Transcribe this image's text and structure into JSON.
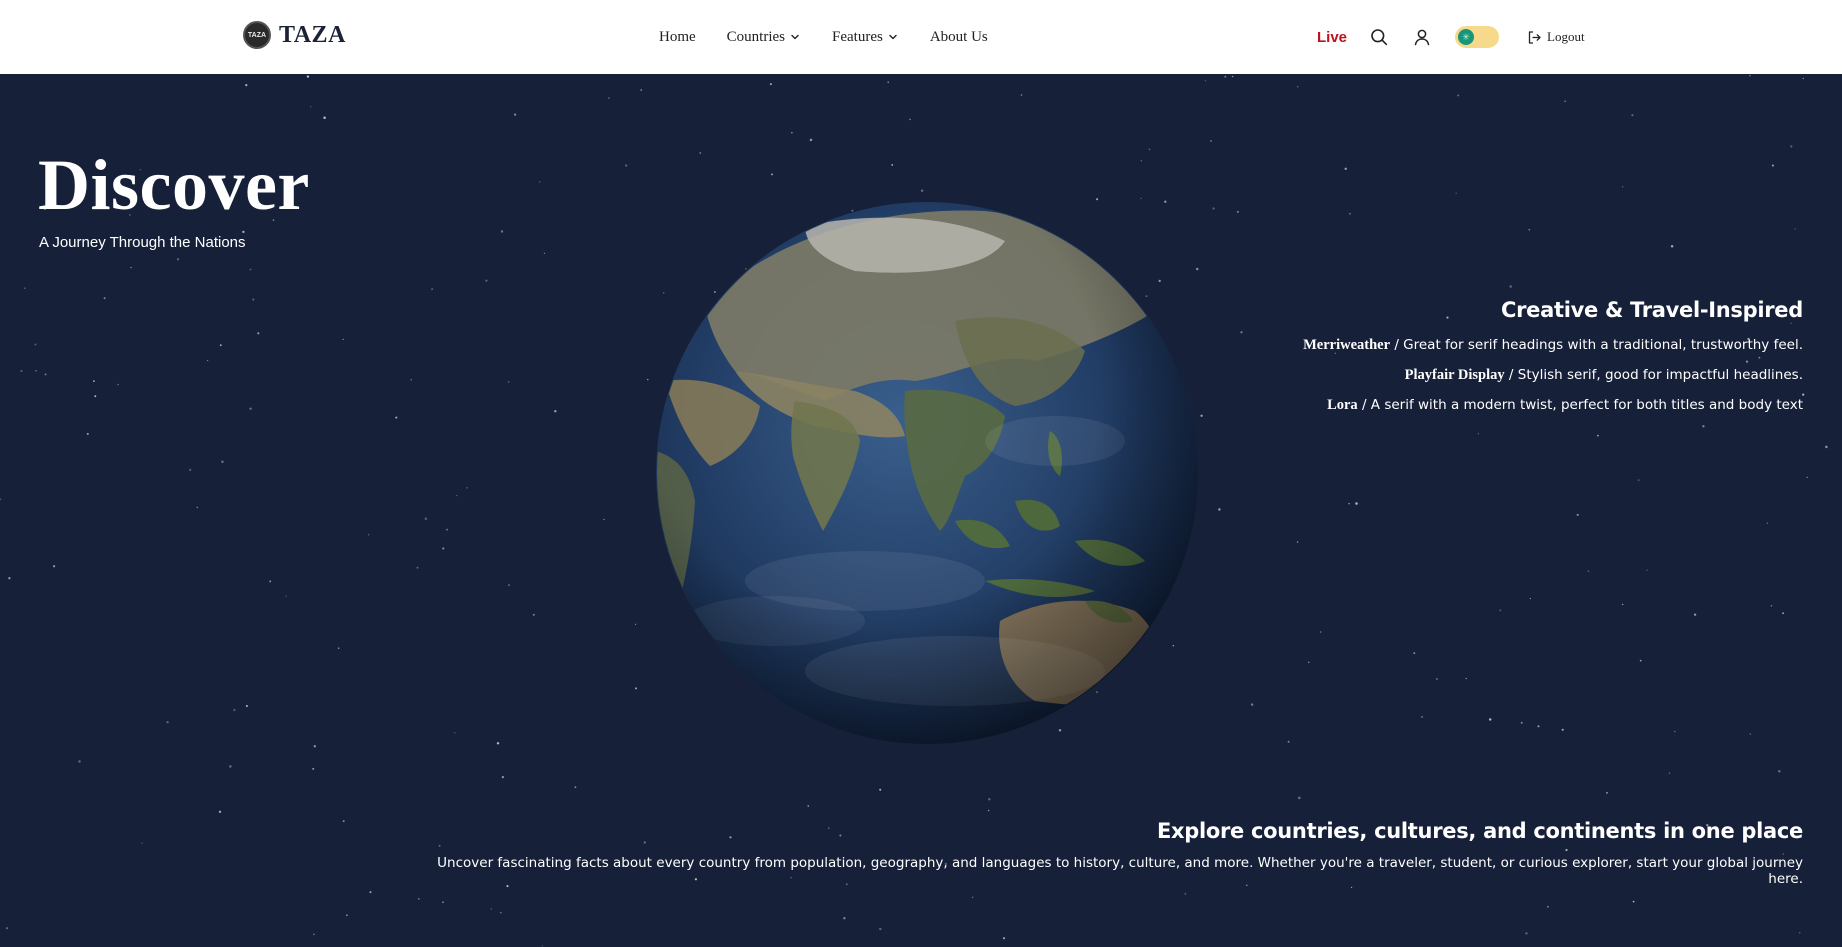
{
  "brand": {
    "logo_text": "TAZA",
    "name": "TAZA"
  },
  "nav": {
    "items": [
      {
        "label": "Home",
        "dropdown": false
      },
      {
        "label": "Countries",
        "dropdown": true
      },
      {
        "label": "Features",
        "dropdown": true
      },
      {
        "label": "About Us",
        "dropdown": false
      }
    ]
  },
  "toolbar": {
    "live_label": "Live",
    "search_icon": "search-icon",
    "user_icon": "user-icon",
    "theme_toggle_on": true,
    "logout_label": "Logout"
  },
  "hero": {
    "title": "Discover",
    "subtitle": "A Journey Through the Nations"
  },
  "fonts_section": {
    "heading": "Creative & Travel-Inspired",
    "lines": [
      {
        "name": "Merriweather",
        "desc": " / Great for serif headings with a traditional, trustworthy feel."
      },
      {
        "name": "Playfair Display",
        "desc": " / Stylish serif, good for impactful headlines."
      },
      {
        "name": "Lora",
        "desc": " / A serif with a modern twist, perfect for both titles and body text"
      }
    ]
  },
  "explore": {
    "heading": "Explore countries, cultures, and continents in one place",
    "text": "Uncover fascinating facts about every country from population, geography, and languages to history, culture, and more. Whether you're a traveler, student, or curious explorer, start your global journey here."
  },
  "colors": {
    "background": "#162039",
    "header_bg": "#ffffff",
    "live_red": "#c0121c",
    "toggle_track": "#f6d98a",
    "toggle_knob": "#17967a"
  }
}
